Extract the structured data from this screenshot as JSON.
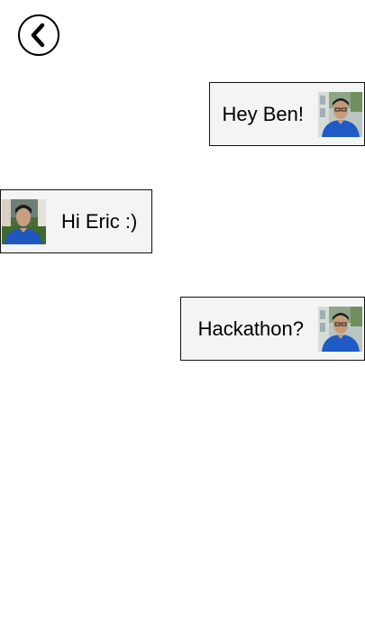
{
  "header": {
    "back_icon": "chevron-left-icon"
  },
  "messages": [
    {
      "text": "Hey Ben!",
      "direction": "outgoing",
      "avatar": "eric-avatar"
    },
    {
      "text": "Hi Eric :)",
      "direction": "incoming",
      "avatar": "ben-avatar"
    },
    {
      "text": "Hackathon?",
      "direction": "outgoing",
      "avatar": "eric-avatar"
    }
  ],
  "colors": {
    "bubble_background": "#f4f4f4",
    "bubble_border": "#111111",
    "shirt_blue": "#1e5bc6"
  }
}
